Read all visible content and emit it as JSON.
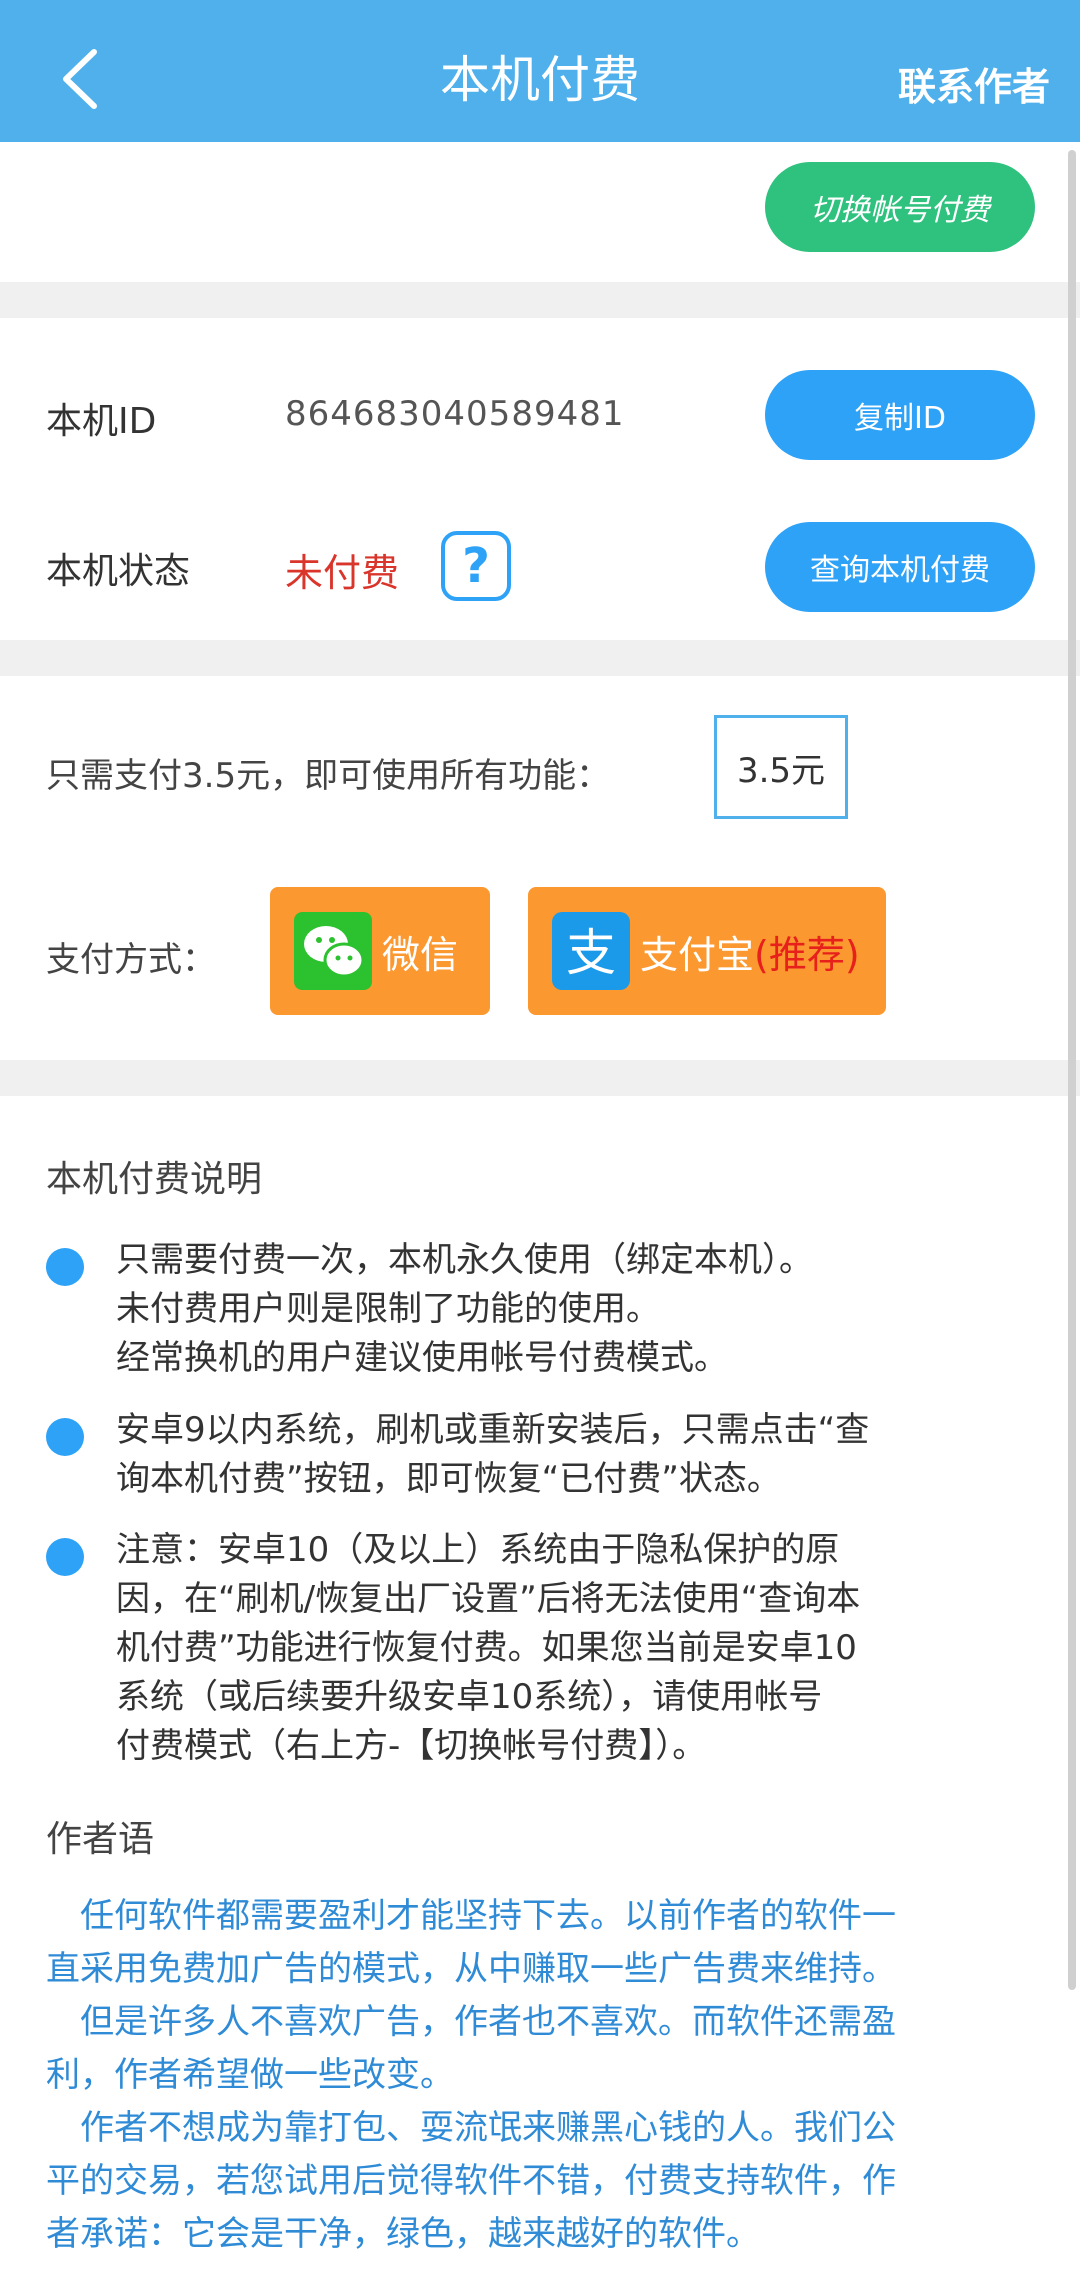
{
  "header": {
    "title": "本机付费",
    "contact_label": "联系作者",
    "back_icon": "chevron-left-icon"
  },
  "switch_button": "切换帐号付费",
  "device": {
    "id_label": "本机ID",
    "id_value": "864683040589481",
    "copy_button": "复制ID",
    "status_label": "本机状态",
    "status_value": "未付费",
    "help_icon": "?",
    "query_button": "查询本机付费"
  },
  "payment": {
    "price_text": "只需支付3.5元，即可使用所有功能：",
    "price_value": "3.5元",
    "method_label": "支付方式：",
    "wechat_label": "微信",
    "alipay_label": "支付宝",
    "alipay_recommend": "(推荐)"
  },
  "explanation": {
    "title": "本机付费说明",
    "bullets": [
      {
        "lines": [
          "只需要付费一次，本机永久使用（绑定本机）。",
          "未付费用户则是限制了功能的使用。",
          "经常换机的用户建议使用帐号付费模式。"
        ]
      },
      {
        "lines": [
          "安卓9以内系统，刷机或重新安装后，只需点击“查",
          "询本机付费”按钮，即可恢复“已付费”状态。"
        ]
      },
      {
        "lines": [
          "注意：安卓10（及以上）系统由于隐私保护的原",
          "因，在“刷机/恢复出厂设置”后将无法使用“查询本",
          "机付费”功能进行恢复付费。如果您当前是安卓10",
          "系统（或后续要升级安卓10系统），请使用帐号",
          "付费模式（右上方-【切换帐号付费】）。"
        ]
      }
    ]
  },
  "author": {
    "title": "作者语",
    "lines": [
      "　任何软件都需要盈利才能坚持下去。以前作者的软件一",
      "直采用免费加广告的模式，从中赚取一些广告费来维持。",
      "　但是许多人不喜欢广告，作者也不喜欢。而软件还需盈",
      "利，作者希望做一些改变。",
      "　作者不想成为靠打包、耍流氓来赚黑心钱的人。我们公",
      "平的交易，若您试用后觉得软件不错，付费支持软件，作",
      "者承诺：它会是干净，绿色，越来越好的软件。"
    ]
  },
  "colors": {
    "header": "#4fb0ec",
    "green_button": "#2fc17e",
    "blue_button": "#2ea2f6",
    "orange_button": "#fb9830",
    "unpaid_red": "#d9352b",
    "author_blue": "#2f8bd6"
  }
}
